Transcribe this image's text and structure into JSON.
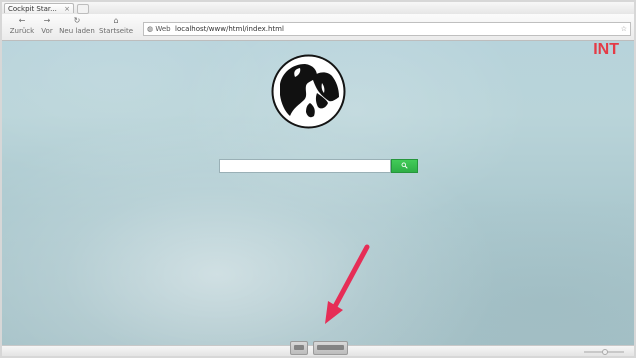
{
  "browser": {
    "tab": {
      "title": "Cockpit Star...",
      "close_label": "×"
    },
    "nav": {
      "back": {
        "label": "Zurück",
        "icon": "left-arrow-icon"
      },
      "forward": {
        "label": "Vor",
        "icon": "right-arrow-icon"
      },
      "reload": {
        "label": "Neu laden",
        "icon": "reload-icon"
      },
      "home": {
        "label": "Startseite",
        "icon": "home-icon"
      }
    },
    "address": {
      "badge": "Web",
      "url": "localhost/www/html/index.html",
      "icon": "globe-icon",
      "star_icon": "star-icon"
    }
  },
  "page": {
    "brand_badge": "INT",
    "search": {
      "value": "",
      "placeholder": "",
      "button_icon": "search-icon"
    },
    "colors": {
      "badge": "#e43b46",
      "search_button": "#37b94b",
      "arrow": "#e62d56",
      "background": "#b7d3db"
    }
  },
  "taskbar": {
    "dock_items": [
      "window-icon",
      "window-icon"
    ]
  }
}
